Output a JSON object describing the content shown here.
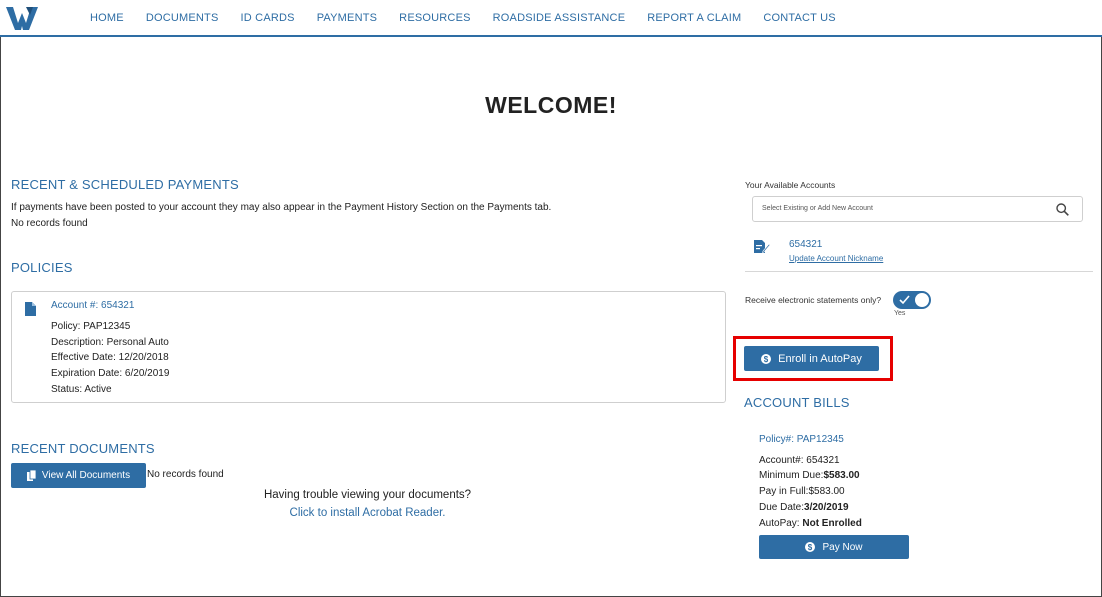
{
  "nav": {
    "items": [
      "HOME",
      "DOCUMENTS",
      "ID CARDS",
      "PAYMENTS",
      "RESOURCES",
      "ROADSIDE ASSISTANCE",
      "REPORT A CLAIM",
      "CONTACT US"
    ]
  },
  "page": {
    "title": "WELCOME!"
  },
  "recent_payments": {
    "title": "RECENT & SCHEDULED PAYMENTS",
    "note": "If payments have been posted to your account they may also appear in the Payment History Section on the Payments tab.",
    "empty": "No records found"
  },
  "policies": {
    "title": "POLICIES",
    "account": "Account #:  654321",
    "policy": "Policy: PAP12345",
    "description": "Description: Personal Auto",
    "effective": "Effective Date: 12/20/2018",
    "expiration": "Expiration Date: 6/20/2019",
    "status": "Status: Active"
  },
  "documents": {
    "title": "RECENT DOCUMENTS",
    "view_all": "View All Documents",
    "empty": "No records found",
    "trouble": "Having trouble viewing your documents?",
    "acrobat_link": "Click to install Acrobat Reader."
  },
  "accounts": {
    "label": "Your Available Accounts",
    "search_placeholder": "Select Existing or Add New Account",
    "account_number": "654321",
    "update_nickname": "Update Account Nickname",
    "estatements_label": "Receive electronic statements only?",
    "toggle_state": "Yes"
  },
  "autopay": {
    "button": "Enroll in AutoPay"
  },
  "bills": {
    "title": "ACCOUNT BILLS",
    "policy": "Policy#:  PAP12345",
    "account": "Account#:  654321",
    "min_due_label": "Minimum Due:",
    "min_due_value": "$583.00",
    "pay_full": "Pay in Full:$583.00",
    "due_date_label": "Due Date:",
    "due_date_value": "3/20/2019",
    "autopay_label": "AutoPay: ",
    "autopay_value": "Not Enrolled",
    "pay_now": "Pay Now"
  },
  "colors": {
    "primary": "#2e6da4",
    "highlight": "#e60000"
  }
}
